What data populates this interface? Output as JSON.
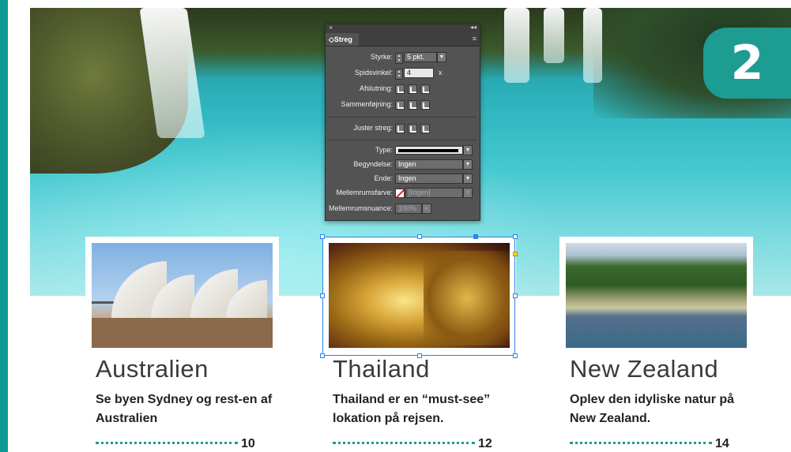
{
  "chapter_number": "2",
  "colors": {
    "accent": "#1d9c92",
    "selection": "#2f80ed"
  },
  "stroke_panel": {
    "tab_label": "◇Streg",
    "close_icon": "×",
    "collapse_icon": "◂◂",
    "menu_icon": "≡",
    "weight_label": "Styrke:",
    "weight_value": "5 pkt.",
    "miter_label": "Spidsvinkel:",
    "miter_value": "4",
    "miter_unit": "x",
    "cap_label": "Afslutning:",
    "join_label": "Sammenføjning:",
    "align_label": "Juster streg:",
    "type_label": "Type:",
    "start_label": "Begyndelse:",
    "start_value": "Ingen",
    "end_label": "Ende:",
    "end_value": "Ingen",
    "gap_color_label": "Mellemrumsfarve:",
    "gap_color_value": "[Ingen]",
    "gap_tint_label": "Mellemrumsnuance:",
    "gap_tint_value": "100%"
  },
  "cards": [
    {
      "title": "Australien",
      "description": "Se byen Sydney og rest-en af Australien",
      "page": "10"
    },
    {
      "title": "Thailand",
      "description": "Thailand er en “must-see” lokation på rejsen.",
      "page": "12"
    },
    {
      "title": "New Zealand",
      "description": "Oplev den idyliske natur på New Zealand.",
      "page": "14"
    }
  ]
}
